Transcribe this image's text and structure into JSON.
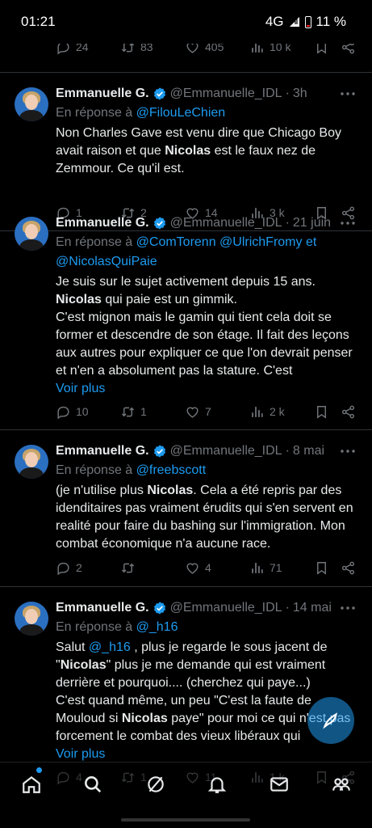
{
  "status_bar": {
    "time": "01:21",
    "network": "4G",
    "battery": "11 %"
  },
  "stub": {
    "replies": "24",
    "reposts": "83",
    "likes": "405",
    "views": "10 k"
  },
  "tweets": [
    {
      "name": "Emmanuelle G.",
      "handle": "@Emmanuelle_IDL",
      "dot": "·",
      "date": "3h",
      "reply_prefix": "En réponse à",
      "mentions": [
        "@FilouLeChien"
      ],
      "text_parts": [
        "Non Charles Gave est venu dire que Chicago Boy avait raison et que ",
        "Nicolas",
        " est le faux nez de Zemmour. Ce qu'il est."
      ],
      "replies": "1",
      "reposts": "2",
      "likes": "14",
      "views": "3 k"
    },
    {
      "name": "Emmanuelle G.",
      "handle": "@Emmanuelle_IDL",
      "dot": "·",
      "date": "21 juin",
      "reply_prefix": "En réponse à",
      "mentions": [
        "@ComTorenn",
        "@UlrichFromy",
        "et",
        "@NicolasQuiPaie"
      ],
      "text_parts": [
        "Je suis sur le sujet activement depuis 15 ans.",
        "Nicolas",
        " qui paie est un gimmik.",
        "C'est mignon mais le gamin qui tient cela doit se former et descendre de son étage. Il fait des leçons aux autres pour expliquer ce que l'on devrait penser et n'en a absolument pas la stature. C'est"
      ],
      "show_more": "Voir plus",
      "replies": "10",
      "reposts": "1",
      "likes": "7",
      "views": "2 k"
    },
    {
      "name": "Emmanuelle G.",
      "handle": "@Emmanuelle_IDL",
      "dot": "·",
      "date": "8 mai",
      "reply_prefix": "En réponse à",
      "mentions": [
        "@freebscott"
      ],
      "text_parts": [
        "(je n'utilise plus ",
        "Nicolas",
        ". Cela a été repris par des idenditaires pas vraiment érudits qui s'en servent en realité pour faire du bashing sur l'immigration. Mon combat économique n'a aucune race."
      ],
      "replies": "2",
      "reposts": "",
      "likes": "4",
      "views": "71"
    },
    {
      "name": "Emmanuelle G.",
      "handle": "@Emmanuelle_IDL",
      "dot": "·",
      "date": "14 mai",
      "reply_prefix": "En réponse à",
      "mentions": [
        "@_h16"
      ],
      "text_parts": [
        "Salut ",
        "@_h16",
        " , plus je regarde le sous jacent de \"",
        "Nicolas",
        "\" plus je me demande qui est vraiment derrière et pourquoi.... (cherchez qui paye...)",
        "C'est quand même, un peu \"C'est la faute de Mouloud si ",
        "Nicolas",
        " paye\" pour moi ce qui n'est pas forcement le combat des vieux libéraux qui"
      ],
      "show_more": "Voir plus",
      "replies": "4",
      "reposts": "1",
      "likes": "11",
      "views": "1 k"
    }
  ],
  "bottom_nav": [
    "home-icon",
    "search-icon",
    "grok-icon",
    "notifications-icon",
    "messages-icon",
    "communities-icon"
  ],
  "colors": {
    "accent": "#1d9bf0",
    "muted": "#71767b",
    "text": "#e7e9ea",
    "divider": "#2f3336"
  }
}
